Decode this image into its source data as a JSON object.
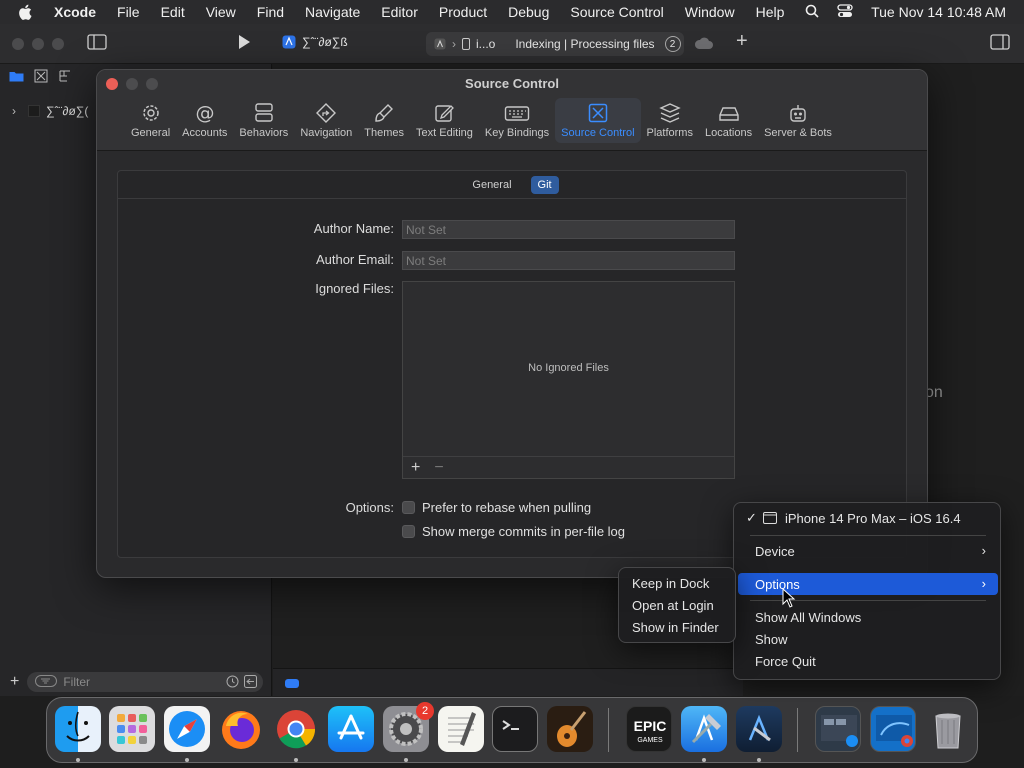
{
  "menubar": {
    "app_name": "Xcode",
    "items": [
      "File",
      "Edit",
      "View",
      "Find",
      "Navigate",
      "Editor",
      "Product",
      "Debug",
      "Source Control",
      "Window",
      "Help"
    ],
    "datetime": "Tue Nov 14  10:48 AM"
  },
  "xcode": {
    "scheme": "∑ˆ¨∂ø∑ß",
    "activity_target": "i...o",
    "activity_status": "Indexing | Processing files",
    "activity_count": "2",
    "project_node": "∑ˆ¨∂ø∑(",
    "filter_placeholder": "Filter",
    "right_fragment": "on"
  },
  "settings": {
    "title": "Source Control",
    "tabs": [
      {
        "label": "General",
        "icon": "gear-icon"
      },
      {
        "label": "Accounts",
        "icon": "at-icon"
      },
      {
        "label": "Behaviors",
        "icon": "behaviors-icon"
      },
      {
        "label": "Navigation",
        "icon": "navigation-icon"
      },
      {
        "label": "Themes",
        "icon": "brush-icon"
      },
      {
        "label": "Text Editing",
        "icon": "pencil-icon"
      },
      {
        "label": "Key Bindings",
        "icon": "keyboard-icon"
      },
      {
        "label": "Source Control",
        "icon": "source-control-icon"
      },
      {
        "label": "Platforms",
        "icon": "platforms-icon"
      },
      {
        "label": "Locations",
        "icon": "drive-icon"
      },
      {
        "label": "Server & Bots",
        "icon": "server-icon"
      }
    ],
    "active_tab": "Source Control",
    "segments": [
      "General",
      "Git"
    ],
    "active_segment": "Git",
    "author_name_label": "Author Name:",
    "author_name_placeholder": "Not Set",
    "author_email_label": "Author Email:",
    "author_email_placeholder": "Not Set",
    "ignored_files_label": "Ignored Files:",
    "ignored_empty": "No Ignored Files",
    "options_label": "Options:",
    "option_rebase": "Prefer to rebase when pulling",
    "option_merge": "Show merge commits in per-file log"
  },
  "context_menu": {
    "device_item": "iPhone 14 Pro Max – iOS 16.4",
    "device": "Device",
    "options": "Options",
    "show_all_windows": "Show All Windows",
    "show": "Show",
    "force_quit": "Force Quit"
  },
  "submenu": {
    "keep_in_dock": "Keep in Dock",
    "open_at_login": "Open at Login",
    "show_in_finder": "Show in Finder"
  },
  "dock": {
    "apps": [
      "finder-icon",
      "launchpad-icon",
      "safari-icon",
      "firefox-icon",
      "chrome-icon",
      "app-store-icon",
      "system-settings-icon",
      "textedit-icon",
      "terminal-icon",
      "garageband-icon",
      "epic-games-icon",
      "xcode-icon",
      "instruments-icon",
      "recent-window-icon",
      "recent-window-icon",
      "trash-icon"
    ],
    "settings_badge": "2",
    "epic_label_1": "EPIC",
    "epic_label_2": "GAMES"
  },
  "colors": {
    "accent": "#2f7cf6",
    "selected_menu": "#1d5ad8",
    "active_tab": "#3a8dff"
  }
}
